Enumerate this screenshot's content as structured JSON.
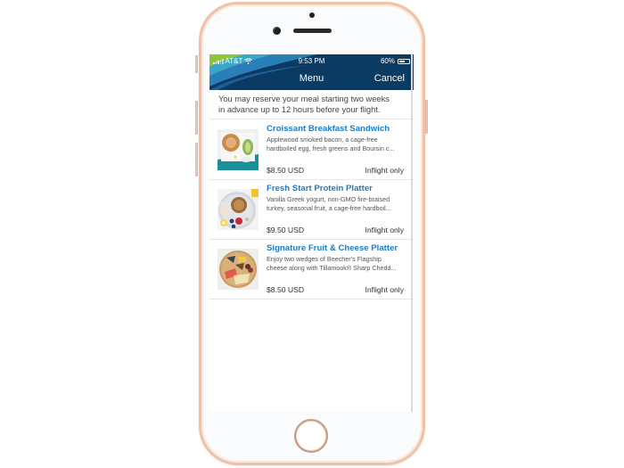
{
  "status_bar": {
    "carrier": "AT&T",
    "time": "9:53 PM",
    "battery_text": "60%",
    "battery_level": 0.6
  },
  "nav": {
    "title": "Menu",
    "cancel_label": "Cancel"
  },
  "notice": {
    "line1": "You may reserve your meal starting two weeks",
    "line2": "in advance up to 12 hours before your flight."
  },
  "colors": {
    "header_bg": "#0b3a63",
    "title_blue": "#1a7cc7",
    "phone_frame": "#efc1a6"
  },
  "menu_items": [
    {
      "title": "Croissant Breakfast Sandwich",
      "desc_line1": "Applewood smoked bacon, a cage-free",
      "desc_line2": "hardboiled egg, fresh greens and Boursin c...",
      "price": "$8.50 USD",
      "availability": "Inflight only"
    },
    {
      "title": "Fresh Start Protein Platter",
      "desc_line1": "Vanilla Greek yogurt, non-GMO fire-braised",
      "desc_line2": "turkey, seasonal fruit, a cage-free hardboil...",
      "price": "$9.50 USD",
      "availability": "Inflight only"
    },
    {
      "title": "Signature Fruit & Cheese Platter",
      "desc_line1": "Enjoy two wedges of Beecher's Flagship",
      "desc_line2": "cheese along with Tillamook® Sharp Chedd...",
      "price": "$8.50 USD",
      "availability": "Inflight only"
    }
  ]
}
